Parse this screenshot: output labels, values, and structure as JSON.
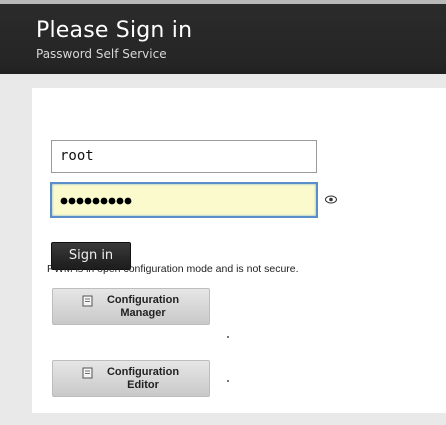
{
  "header": {
    "title": "Please Sign in",
    "subtitle": "Password Self Service"
  },
  "login": {
    "username_value": "root",
    "password_value": "●●●●●●●●●",
    "show_password_icon": "eye-icon",
    "sign_in_label": "Sign in"
  },
  "notice": "PWM is in open configuration mode and is not secure.",
  "config_buttons": [
    {
      "label": "Configuration Manager",
      "icon": "document-icon"
    },
    {
      "label": "Configuration Editor",
      "icon": "document-icon"
    }
  ],
  "colors": {
    "header_bg": "#242424",
    "password_bg": "#fafacc",
    "focus_border": "#5b8fc8"
  }
}
